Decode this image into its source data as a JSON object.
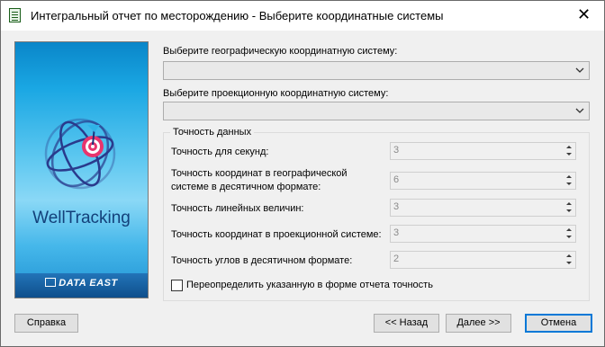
{
  "window": {
    "title": "Интегральный отчет по месторождению - Выберите координатные системы",
    "close_glyph": "✕"
  },
  "banner": {
    "brand": "WellTracking",
    "footer": "DATA EAST"
  },
  "geo_system": {
    "label": "Выберите географическую координатную систему:",
    "value": ""
  },
  "proj_system": {
    "label": "Выберите проекционную координатную систему:",
    "value": ""
  },
  "accuracy": {
    "group_title": "Точность данных",
    "fields": [
      {
        "label": "Точность для секунд:",
        "value": "3"
      },
      {
        "label_line1": "Точность  координат  в  географической",
        "label_line2": "системе в десятичном формате:",
        "value": "6"
      },
      {
        "label": "Точность линейных величин:",
        "value": "3"
      },
      {
        "label": "Точность координат в проекционной системе:",
        "value": "3"
      },
      {
        "label": "Точность углов в десятичном формате:",
        "value": "2"
      }
    ],
    "override": {
      "label": "Переопределить указанную в форме отчета точность",
      "checked": false
    }
  },
  "buttons": {
    "help": "Справка",
    "back": "<< Назад",
    "next": "Далее >>",
    "cancel": "Отмена"
  },
  "icons": {
    "app": "document-icon",
    "combo": "chevron-down-icon",
    "spin": "spinner-arrows-icon",
    "logo": "globe-target-icon"
  }
}
